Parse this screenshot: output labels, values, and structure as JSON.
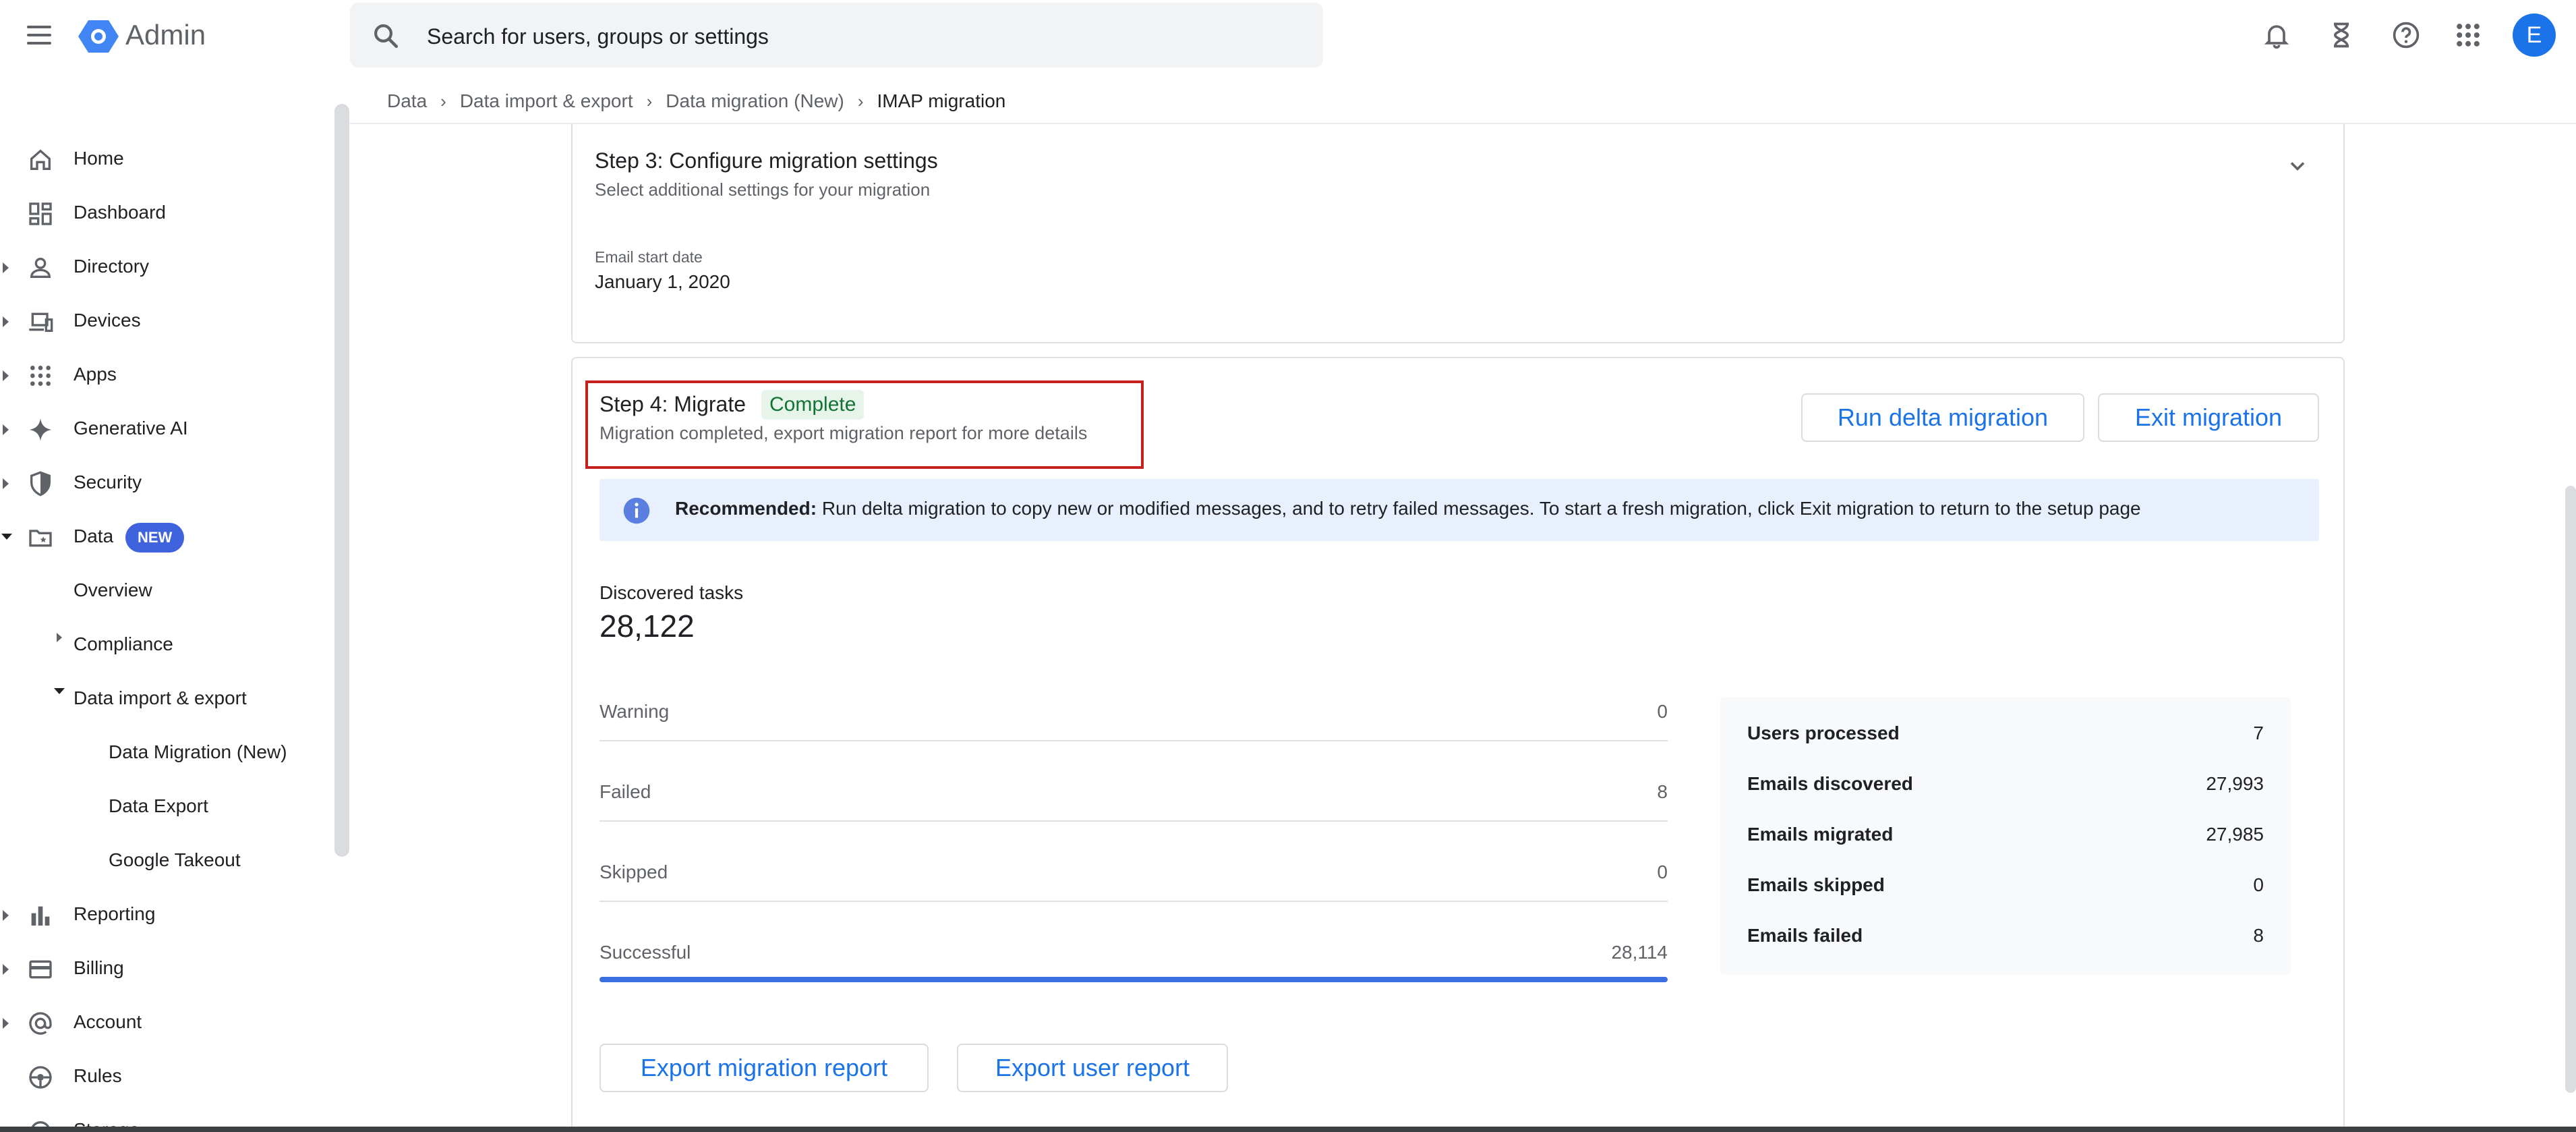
{
  "app": {
    "title": "Admin"
  },
  "search": {
    "placeholder": "Search for users, groups or settings"
  },
  "user": {
    "avatar_letter": "E"
  },
  "breadcrumb": [
    "Data",
    "Data import & export",
    "Data migration (New)",
    "IMAP migration"
  ],
  "sidebar": {
    "items": [
      {
        "label": "Home",
        "icon": "home-icon",
        "expandable": false
      },
      {
        "label": "Dashboard",
        "icon": "dashboard-icon",
        "expandable": false
      },
      {
        "label": "Directory",
        "icon": "person-icon",
        "expandable": true
      },
      {
        "label": "Devices",
        "icon": "devices-icon",
        "expandable": true
      },
      {
        "label": "Apps",
        "icon": "apps-grid-icon",
        "expandable": true
      },
      {
        "label": "Generative AI",
        "icon": "sparkle-icon",
        "expandable": true
      },
      {
        "label": "Security",
        "icon": "shield-icon",
        "expandable": true
      },
      {
        "label": "Data",
        "icon": "folder-icon",
        "expandable": true,
        "expanded": true,
        "badge": "NEW"
      },
      {
        "label": "Reporting",
        "icon": "bar-chart-icon",
        "expandable": true
      },
      {
        "label": "Billing",
        "icon": "credit-card-icon",
        "expandable": true
      },
      {
        "label": "Account",
        "icon": "at-sign-icon",
        "expandable": true
      },
      {
        "label": "Rules",
        "icon": "rules-icon",
        "expandable": false
      },
      {
        "label": "Storage",
        "icon": "storage-icon",
        "expandable": false
      }
    ],
    "data_children": [
      "Overview",
      "Compliance",
      "Data import & export"
    ],
    "import_export_children": [
      "Data Migration (New)",
      "Data Export",
      "Google Takeout"
    ]
  },
  "step3": {
    "title": "Step 3: Configure migration settings",
    "subtitle": "Select additional settings for your migration",
    "field_label": "Email start date",
    "field_value": "January 1, 2020"
  },
  "step4": {
    "title": "Step 4: Migrate",
    "status": "Complete",
    "subtitle": "Migration completed, export migration report for more details",
    "run_delta_label": "Run delta migration",
    "exit_label": "Exit migration",
    "banner_bold": "Recommended:",
    "banner_text": " Run delta migration to copy new or modified messages, and to retry failed messages. To start a fresh migration, click Exit migration to return to the setup page",
    "discovered_label": "Discovered tasks",
    "discovered_value": "28,122",
    "stats": [
      {
        "label": "Warning",
        "value": "0"
      },
      {
        "label": "Failed",
        "value": "8"
      },
      {
        "label": "Skipped",
        "value": "0"
      },
      {
        "label": "Successful",
        "value": "28,114"
      }
    ],
    "progress_fraction": 0.9997,
    "summary": [
      {
        "label": "Users processed",
        "value": "7"
      },
      {
        "label": "Emails discovered",
        "value": "27,993"
      },
      {
        "label": "Emails migrated",
        "value": "27,985"
      },
      {
        "label": "Emails skipped",
        "value": "0"
      },
      {
        "label": "Emails failed",
        "value": "8"
      }
    ],
    "export_migration_label": "Export migration report",
    "export_user_label": "Export user report"
  },
  "colors": {
    "accent": "#1a73e8",
    "success_bg": "#e6f4ea",
    "success_text": "#137333",
    "highlight": "#c5221f"
  }
}
